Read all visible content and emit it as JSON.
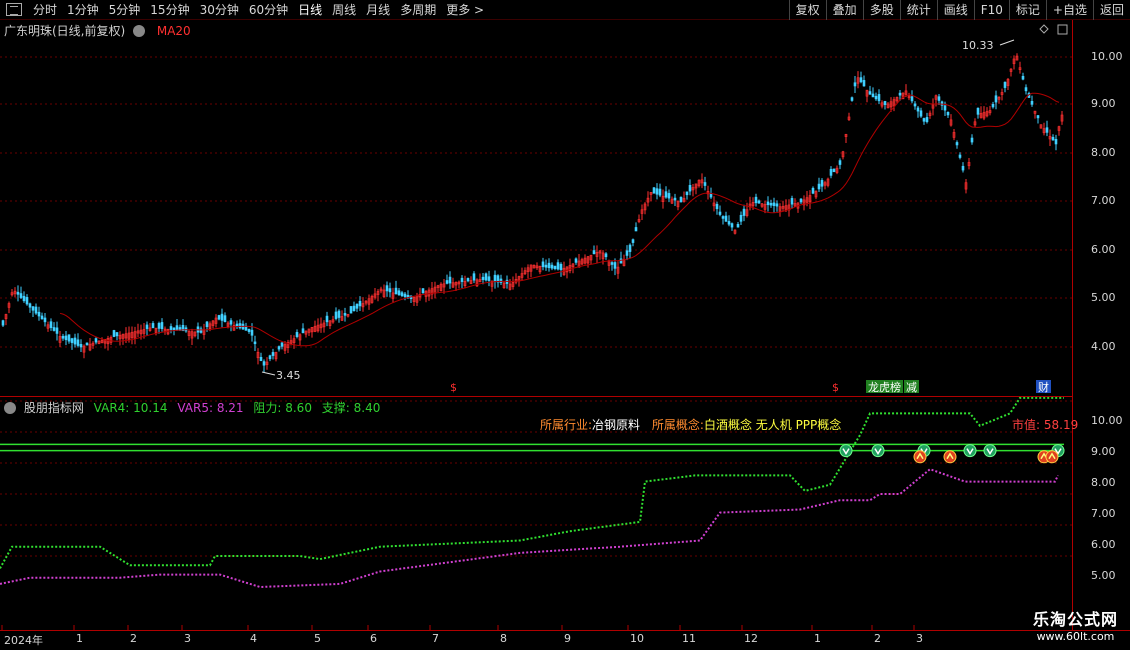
{
  "toolbar": {
    "periods": [
      "分时",
      "1分钟",
      "5分钟",
      "15分钟",
      "30分钟",
      "60分钟",
      "日线",
      "周线",
      "月线",
      "多周期",
      "更多 >"
    ],
    "active_period": "日线",
    "actions": [
      "复权",
      "叠加",
      "多股",
      "统计",
      "画线",
      "F10",
      "标记",
      "+自选",
      "返回"
    ]
  },
  "main_panel": {
    "stock_title": "广东明珠(日线,前复权)",
    "ma_label": "MA20",
    "high_marker": "10.33",
    "low_marker": "3.45",
    "price_axis": [
      "10.00",
      "9.00",
      "8.00",
      "7.00",
      "6.00",
      "5.00",
      "4.00"
    ],
    "event_tags": [
      {
        "text": "$",
        "color": "#ff3030"
      },
      {
        "text": "$",
        "color": "#ff3030"
      },
      {
        "text": "龙虎榜",
        "color": "#ffffff",
        "bg": "#208020"
      },
      {
        "text": "减",
        "color": "#ffffff",
        "bg": "#208020"
      },
      {
        "text": "财",
        "color": "#ffffff",
        "bg": "#2050c0"
      }
    ]
  },
  "indicator": {
    "name": "股朋指标网",
    "var4": "VAR4: 10.14",
    "var5": "VAR5: 8.21",
    "resistance": "阻力: 8.60",
    "support": "支撑: 8.40",
    "industry_key": "所属行业:",
    "industry_val": "冶钢原料",
    "concept_key": "所属概念:",
    "concept_val": "白酒概念 无人机 PPP概念",
    "market_cap": "市值: 58.19",
    "axis": [
      "10.00",
      "9.00",
      "8.00",
      "7.00",
      "6.00",
      "5.00"
    ]
  },
  "date_axis": [
    "2024年",
    "1",
    "2",
    "3",
    "4",
    "5",
    "6",
    "7",
    "8",
    "9",
    "10",
    "11",
    "12",
    "1",
    "2",
    "3"
  ],
  "watermark": {
    "title": "乐淘公式网",
    "url": "www.60lt.com"
  },
  "colors": {
    "up": "#ff3030",
    "down": "#40d0ff",
    "grid": "#6a0000",
    "green_line": "#30e030",
    "purple_line": "#d040d0"
  }
}
